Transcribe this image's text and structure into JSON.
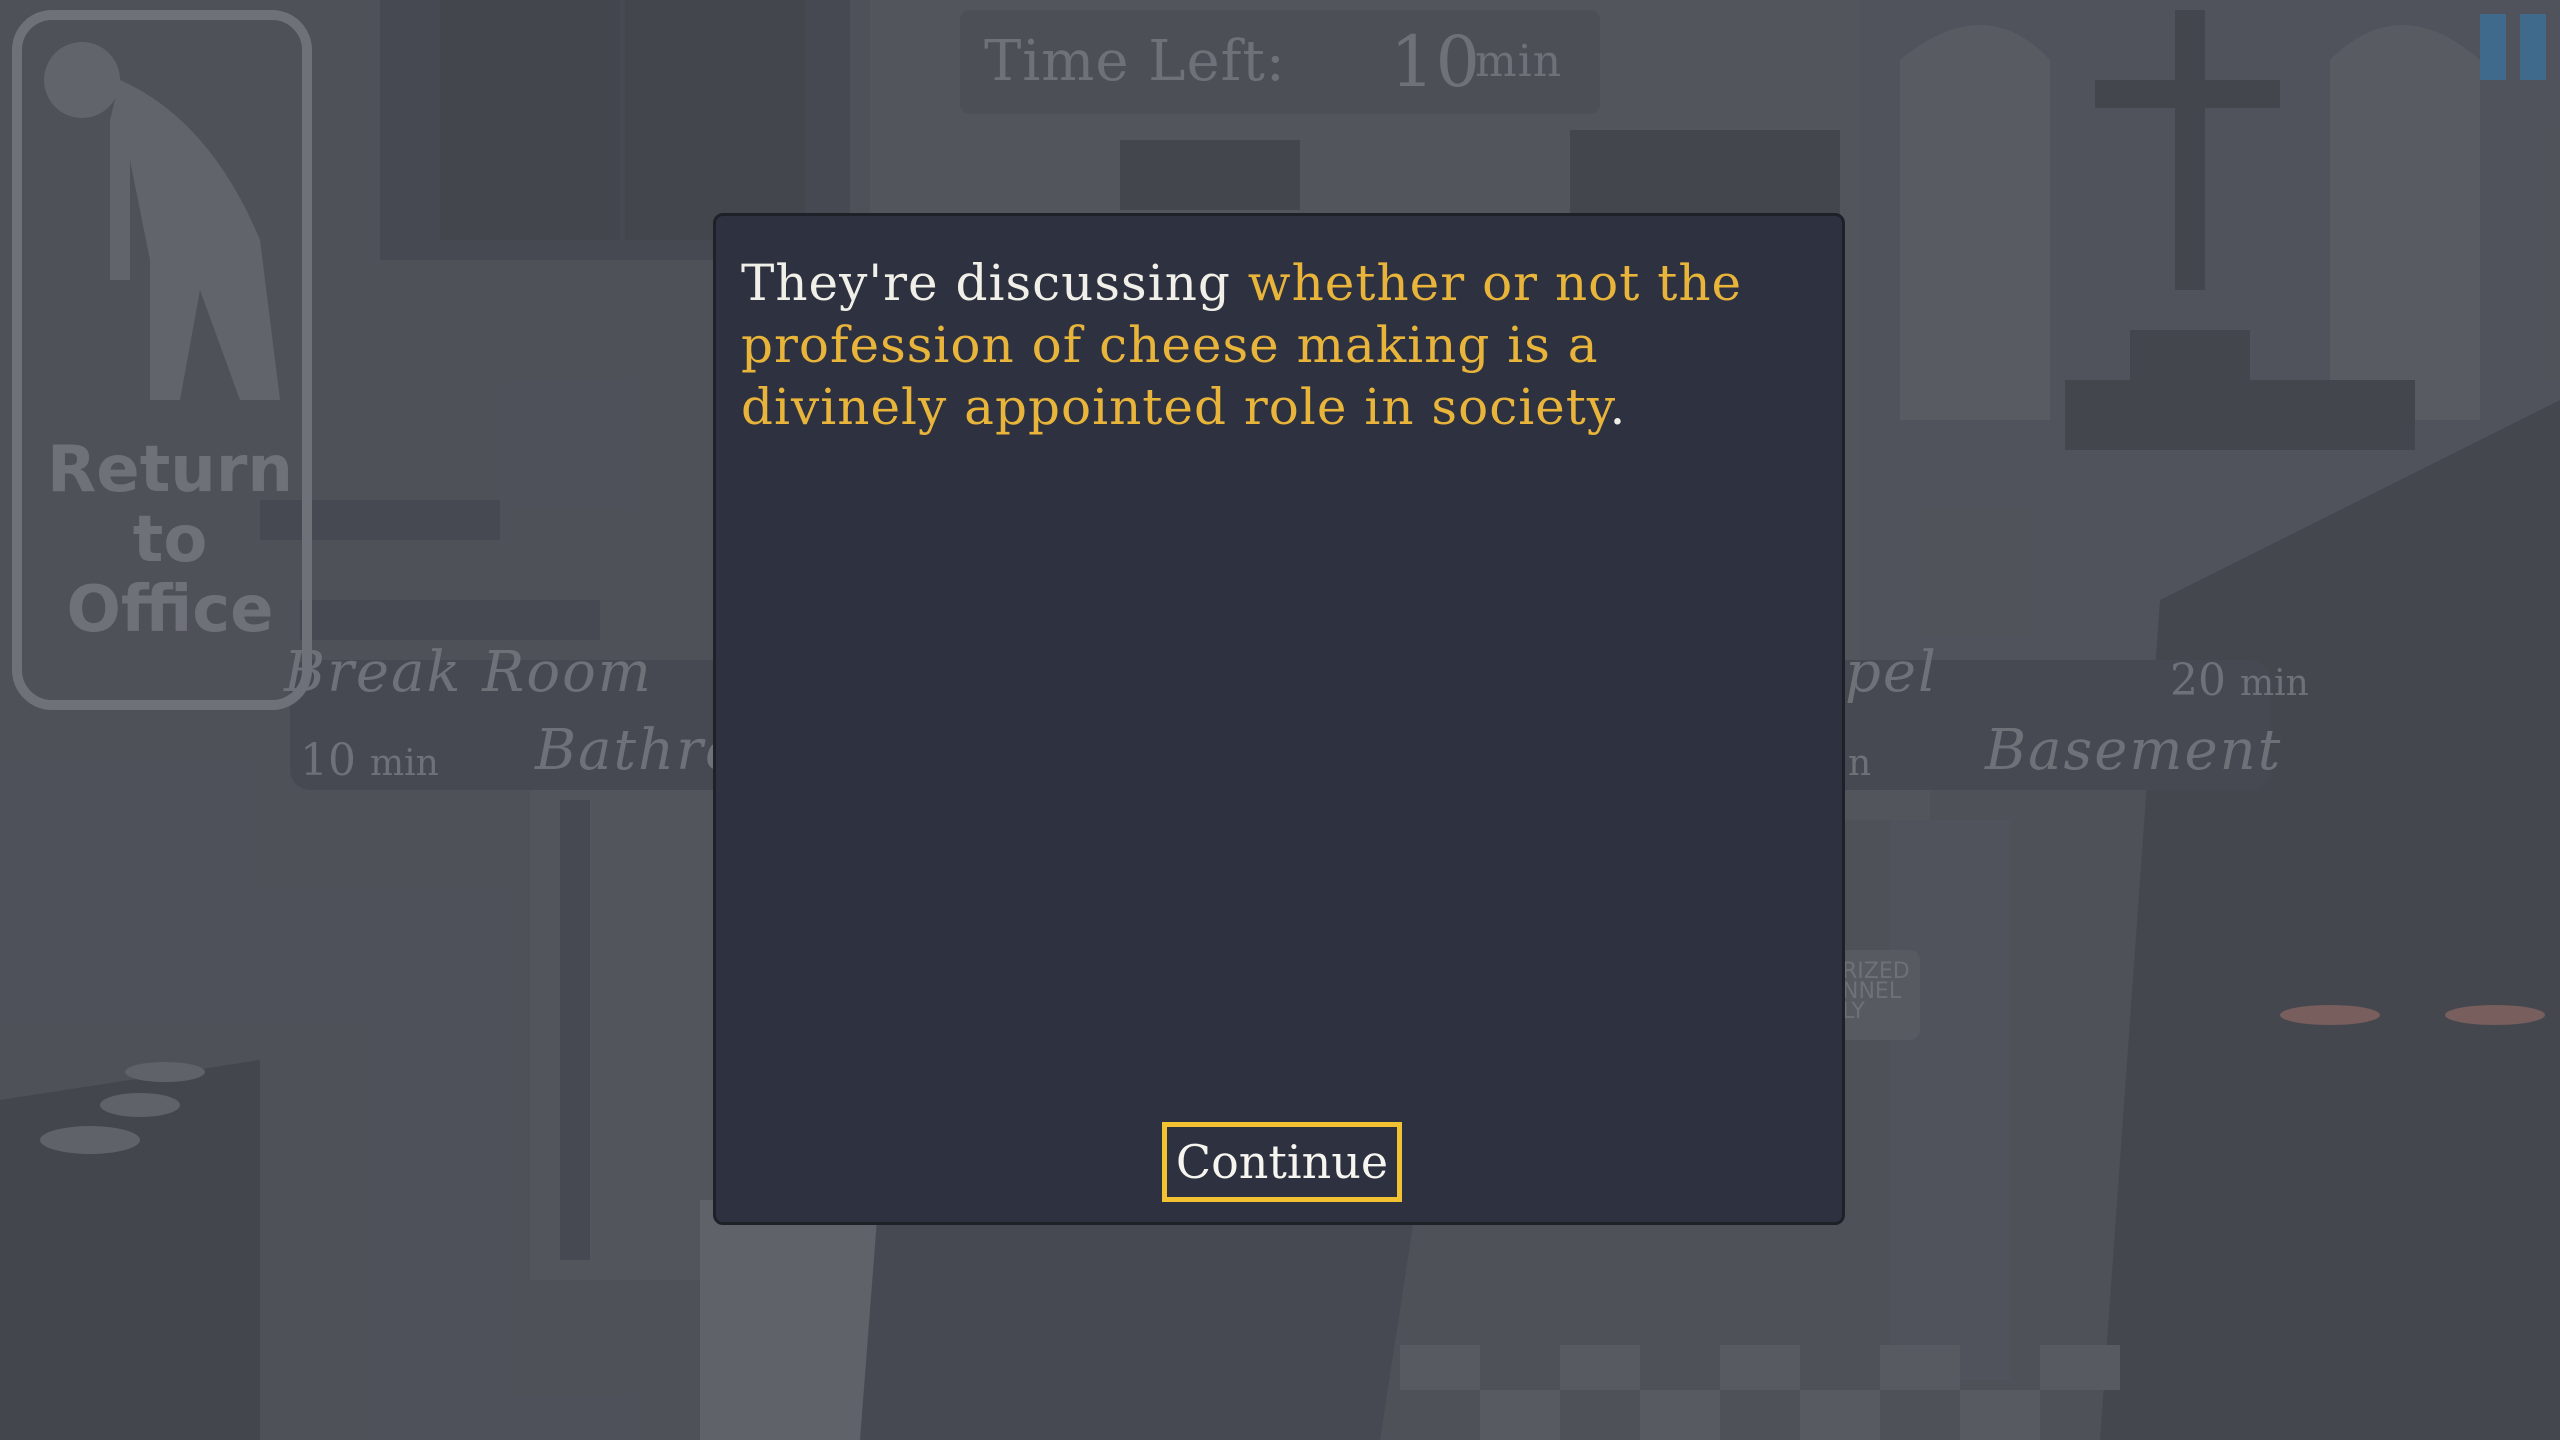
{
  "hud": {
    "time_label": "Time Left:",
    "time_value": "10",
    "time_unit": "min"
  },
  "return_sign": {
    "line1": "Return",
    "line2": "to",
    "line3": "Office"
  },
  "locations": {
    "break_room": "Break Room",
    "bathroom": "Bathro",
    "chapel": "pel",
    "basement": "Basement",
    "break_room_time": "10",
    "chapel_time": "20",
    "basement_time_partial": "n",
    "unit": "min"
  },
  "door_sign": {
    "line1": "RIZED",
    "line2": "NNEL",
    "line3": "LY"
  },
  "dialog": {
    "text_plain": "They're discussing ",
    "text_highlight": "whether or not the profession of cheese making is a divinely appointed role in society",
    "text_end": ".",
    "continue_label": "Continue"
  },
  "colors": {
    "highlight": "#e8b43a",
    "button_border": "#f2c232",
    "dialog_bg": "#2e3140",
    "scene_bg": "#54565e"
  }
}
